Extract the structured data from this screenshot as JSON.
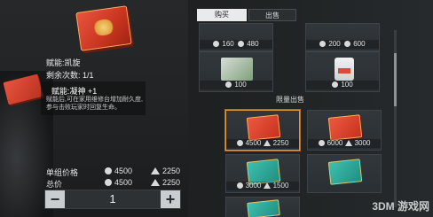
{
  "detail": {
    "talent": "赋能:凯旋",
    "uses_left": "剩余次数: 1/1",
    "tooltip_title": "赋能:凝神 +1",
    "tooltip_text": "赋能后,可在家用维修台增加耐久度,参与击败玩家时回复生命。",
    "unit_price_label": "单组价格",
    "unit_price_coin": "4500",
    "unit_price_tri": "2250",
    "total_label": "总价",
    "total_coin": "4500",
    "total_tri": "2250",
    "quantity": "1",
    "minus": "−",
    "plus": "+"
  },
  "tabs": {
    "buy": "购买",
    "sell": "出售"
  },
  "section": {
    "limited_sale": "限量出售"
  },
  "cards": [
    {
      "price_coin": "160",
      "price_tri": "480",
      "art": "kit"
    },
    {
      "price_coin": "200",
      "price_tri": "600",
      "art": "kit"
    },
    {
      "price_coin": "100",
      "price_tri": "",
      "art": "green-box"
    },
    {
      "price_coin": "100",
      "price_tri": "",
      "art": "bottle"
    },
    {
      "price_coin": "4500",
      "price_tri": "2250",
      "art": "red-book",
      "selected": true
    },
    {
      "price_coin": "6000",
      "price_tri": "3000",
      "art": "red-book"
    },
    {
      "price_coin": "3000",
      "price_tri": "1500",
      "art": "teal-book"
    },
    {
      "price_coin": "",
      "price_tri": "",
      "art": "teal-book"
    }
  ],
  "watermark": "3DM 游戏网",
  "colors": {
    "accent": "#e8963a",
    "buy_tab": "#e8eaeb"
  }
}
